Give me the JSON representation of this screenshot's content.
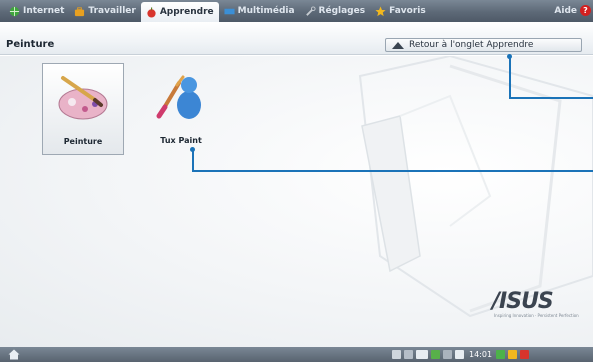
{
  "tabs": [
    {
      "label": "Internet",
      "icon": "globe-icon",
      "color": "#3fa63c"
    },
    {
      "label": "Travailler",
      "icon": "briefcase-icon",
      "color": "#e8a020"
    },
    {
      "label": "Apprendre",
      "icon": "apple-icon",
      "color": "#d8342c"
    },
    {
      "label": "Multimédia",
      "icon": "film-icon",
      "color": "#3b8fd6"
    },
    {
      "label": "Réglages",
      "icon": "tools-icon",
      "color": "#c7ccd2"
    },
    {
      "label": "Favoris",
      "icon": "star-icon",
      "color": "#f2b81e"
    }
  ],
  "help": {
    "label": "Aide"
  },
  "page_title": "Peinture",
  "back_button": {
    "label": "Retour à l'onglet Apprendre"
  },
  "apps": [
    {
      "label": "Peinture",
      "icon": "paint-palette-icon"
    },
    {
      "label": "Tux Paint",
      "icon": "tux-paint-icon"
    }
  ],
  "brand": {
    "logo": "/ISUS",
    "tagline": "Inspiring Innovation · Persistent Perfection"
  },
  "taskbar": {
    "clock": "14:01"
  }
}
